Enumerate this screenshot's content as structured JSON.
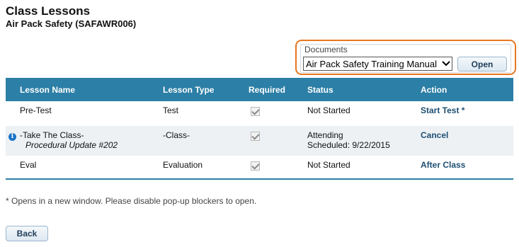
{
  "page": {
    "title": "Class Lessons",
    "subtitle": "Air Pack Safety (SAFAWR006)"
  },
  "documents": {
    "legend": "Documents",
    "selected": "Air Pack Safety Training Manual",
    "open_label": "Open",
    "highlight_color": "#e87722"
  },
  "table": {
    "headers": {
      "name": "Lesson Name",
      "type": "Lesson Type",
      "required": "Required",
      "status": "Status",
      "action": "Action"
    },
    "header_color": "#2c7fa6",
    "rows": [
      {
        "info_icon": "",
        "name": "Pre-Test",
        "sub_name": "",
        "type": "Test",
        "required": true,
        "status": "Not Started",
        "status_sub": "",
        "action": "Start Test *"
      },
      {
        "info_icon": "info-icon",
        "name": "-Take The Class-",
        "sub_name": "Procedural Update #202",
        "type": "-Class-",
        "required": true,
        "status": "Attending",
        "status_sub": "Scheduled: 9/22/2015",
        "action": "Cancel"
      },
      {
        "info_icon": "",
        "name": "Eval",
        "sub_name": "",
        "type": "Evaluation",
        "required": true,
        "status": "Not Started",
        "status_sub": "",
        "action": "After Class"
      }
    ]
  },
  "footnote": "* Opens in a new window. Please disable pop-up blockers to open.",
  "back_label": "Back"
}
